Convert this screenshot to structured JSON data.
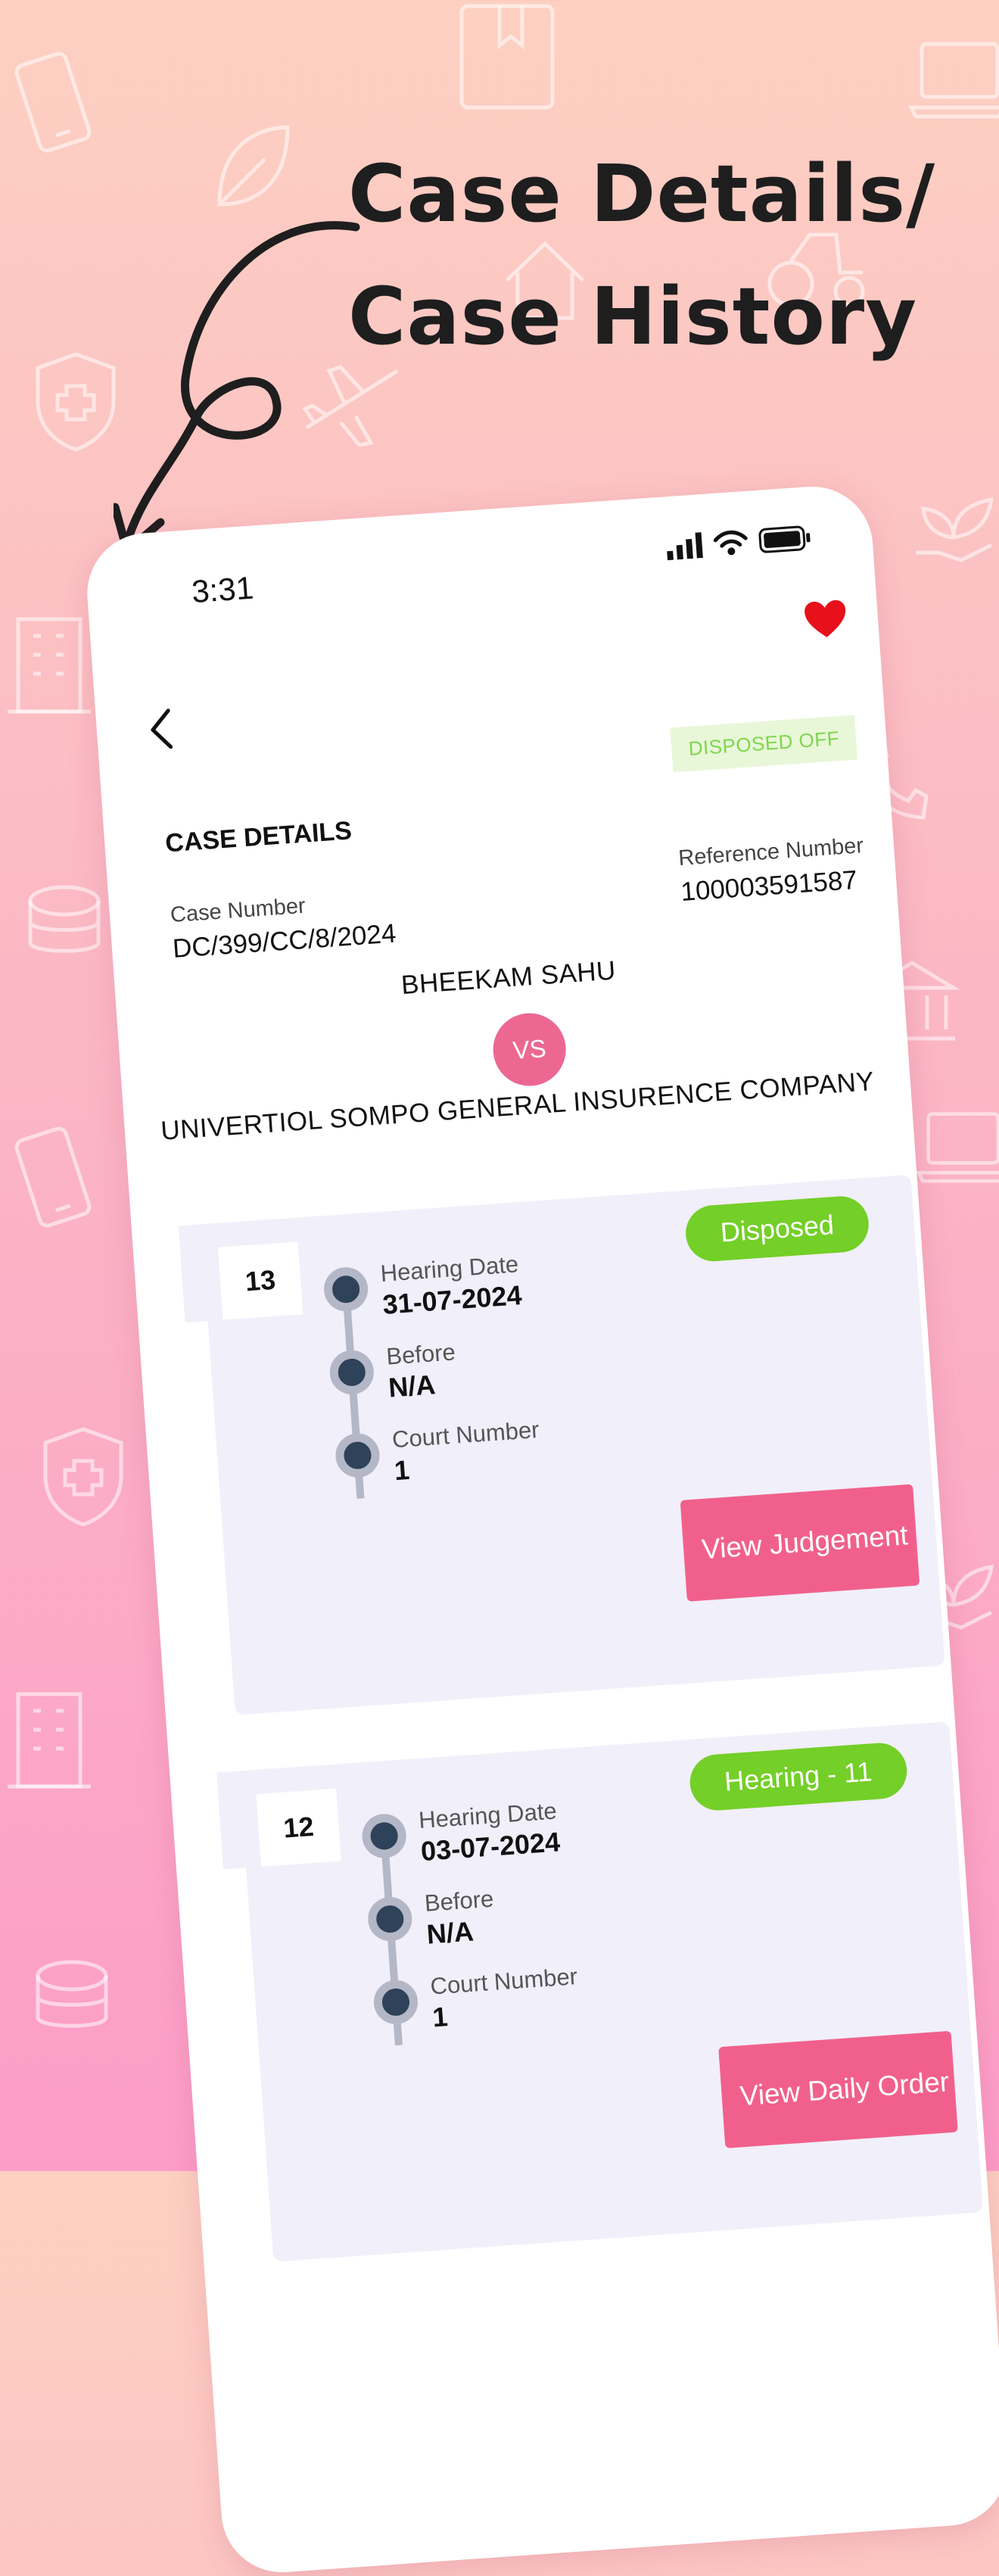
{
  "headline": {
    "line1": "Case Details/",
    "line2": "Case History"
  },
  "status_bar": {
    "time": "3:31"
  },
  "screen": {
    "status_chip": "DISPOSED OFF",
    "title": "CASE DETAILS",
    "case_number": {
      "label": "Case Number",
      "value": "DC/399/CC/8/2024"
    },
    "reference_number": {
      "label": "Reference Number",
      "value": "100003591587"
    },
    "petitioner": "BHEEKAM SAHU",
    "vs_label": "VS",
    "respondent": "UNIVERTIOL SOMPO GENERAL INSURENCE COMPANY"
  },
  "hearings": [
    {
      "number": "13",
      "status": "Disposed",
      "hearing_date_label": "Hearing Date",
      "hearing_date": "31-07-2024",
      "before_label": "Before",
      "before": "N/A",
      "court_label": "Court Number",
      "court": "1",
      "action": "View Judgement"
    },
    {
      "number": "12",
      "status": "Hearing - 11",
      "hearing_date_label": "Hearing Date",
      "hearing_date": "03-07-2024",
      "before_label": "Before",
      "before": "N/A",
      "court_label": "Court Number",
      "court": "1",
      "action": "View Daily Order"
    }
  ],
  "colors": {
    "accent_pink": "#f1608c",
    "status_green": "#74cf28",
    "heart_red": "#e8101a",
    "card_bg": "#f1effa"
  },
  "icons": {
    "background": [
      "phone-icon",
      "book-icon",
      "laptop-icon",
      "leaf-icon",
      "tractor-icon",
      "house-icon",
      "shield-plus-icon",
      "airplane-icon",
      "plant-hand-icon",
      "building-icon",
      "telephone-icon",
      "coins-icon",
      "bank-icon"
    ],
    "status": [
      "signal-icon",
      "wifi-icon",
      "battery-icon"
    ],
    "app": [
      "back-chevron-icon",
      "heart-icon",
      "curved-arrow-icon"
    ]
  }
}
